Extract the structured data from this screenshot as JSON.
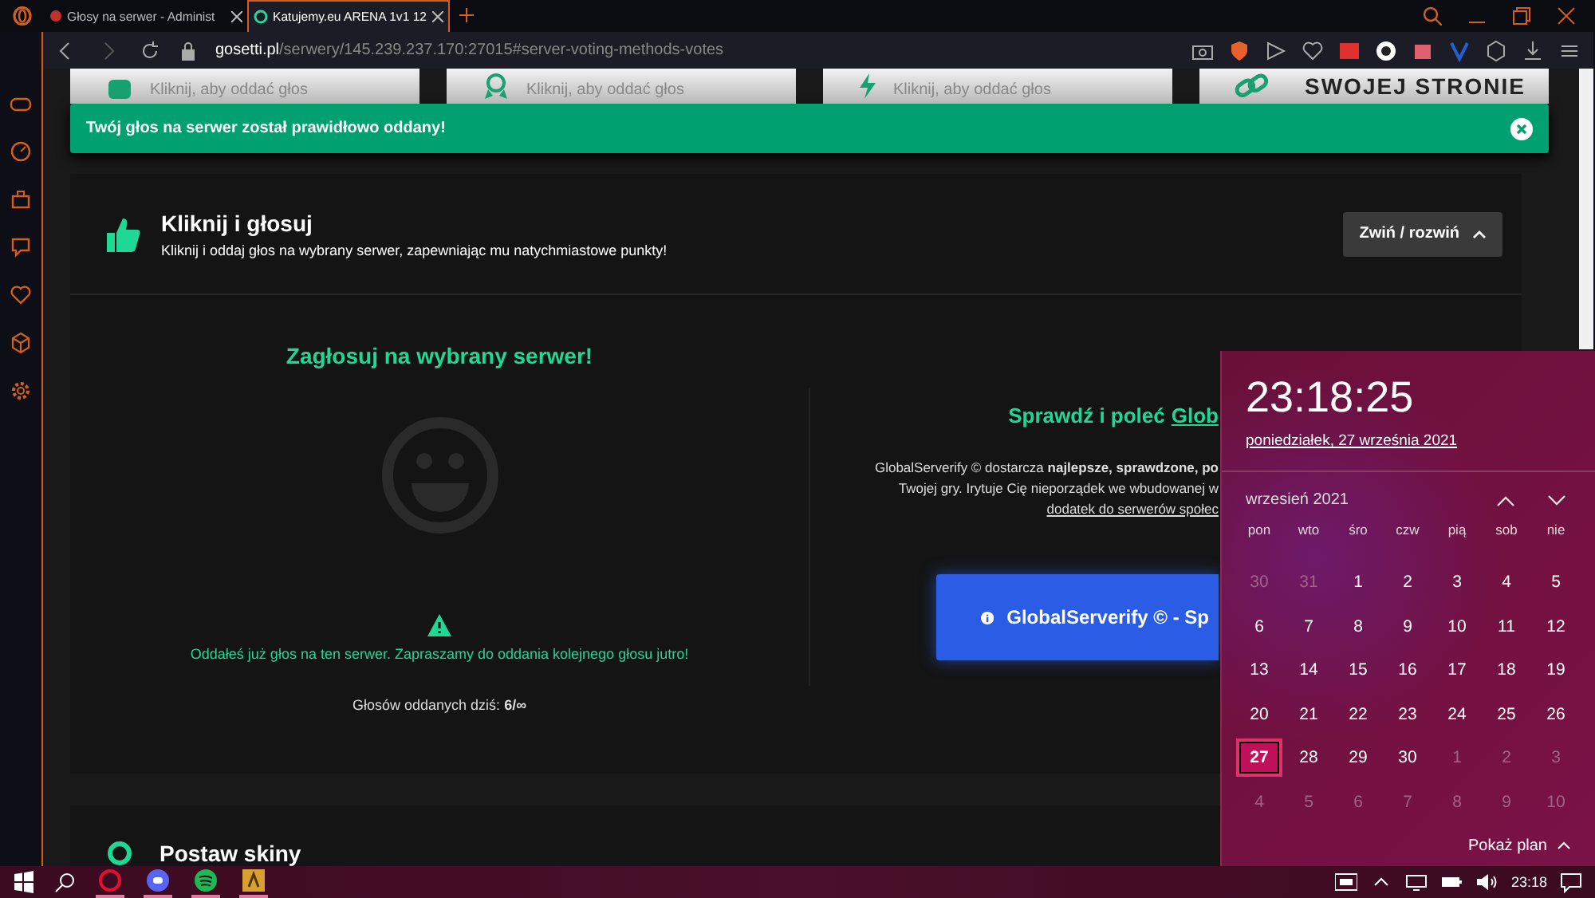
{
  "browser": {
    "tabs": [
      {
        "title": "Głosy na serwer - Administ",
        "selected": false
      },
      {
        "title": "Katujemy.eu ARENA 1v1 12",
        "selected": true
      }
    ],
    "url_host": "gosetti.pl",
    "url_path": "/serwery/145.239.237.170:27015#server-voting-methods-votes"
  },
  "vote_methods": [
    {
      "kind": "click",
      "subtitle": "Kliknij, aby oddać głos"
    },
    {
      "kind": "skins",
      "subtitle": "Kliknij, aby oddać głos"
    },
    {
      "kind": "sms",
      "subtitle": "Kliknij, aby oddać głos"
    },
    {
      "kind": "link",
      "title": "SWOJEJ STRONIE"
    }
  ],
  "alert": {
    "message": "Twój głos na serwer został prawidłowo oddany!"
  },
  "section": {
    "title": "Kliknij i głosuj",
    "description": "Kliknij i oddaj głos na wybrany serwer, zapewniając mu natychmiastowe punkty!",
    "toggle_button": "Zwiń / rozwiń"
  },
  "vote_panel": {
    "heading": "Zagłosuj na wybrany serwer!",
    "notice": "Oddałeś już głos na ten serwer. Zapraszamy do oddania kolejnego głosu jutro!",
    "votes_today": "Głosów oddanych dziś: **6/∞**"
  },
  "promo_panel": {
    "heading": "Sprawdź i poleć",
    "heading_link": "Glob",
    "lines": [
      "GlobalServerify © dostarcza **najlepsze, sprawdzone, po**",
      "Twojej gry. Irytuje Cię nieporządek we wbudowanej w"
    ],
    "link": "dodatek do serwerów społec",
    "button": "GlobalServerify © - Sp"
  },
  "next_section": {
    "title": "Postaw skiny"
  },
  "calendar": {
    "time": "23:18:25",
    "date": "poniedziałek, 27 września 2021",
    "month": "wrzesień 2021",
    "weekdays": [
      "pon",
      "wto",
      "śro",
      "czw",
      "pią",
      "sob",
      "nie"
    ],
    "days": [
      {
        "d": "30",
        "dim": true,
        "selected": false
      },
      {
        "d": "31",
        "dim": true,
        "selected": false
      },
      {
        "d": "1",
        "dim": false,
        "selected": false
      },
      {
        "d": "2",
        "dim": false,
        "selected": false
      },
      {
        "d": "3",
        "dim": false,
        "selected": false
      },
      {
        "d": "4",
        "dim": false,
        "selected": false
      },
      {
        "d": "5",
        "dim": false,
        "selected": false
      },
      {
        "d": "6",
        "dim": false,
        "selected": false
      },
      {
        "d": "7",
        "dim": false,
        "selected": false
      },
      {
        "d": "8",
        "dim": false,
        "selected": false
      },
      {
        "d": "9",
        "dim": false,
        "selected": false
      },
      {
        "d": "10",
        "dim": false,
        "selected": false
      },
      {
        "d": "11",
        "dim": false,
        "selected": false
      },
      {
        "d": "12",
        "dim": false,
        "selected": false
      },
      {
        "d": "13",
        "dim": false,
        "selected": false
      },
      {
        "d": "14",
        "dim": false,
        "selected": false
      },
      {
        "d": "15",
        "dim": false,
        "selected": false
      },
      {
        "d": "16",
        "dim": false,
        "selected": false
      },
      {
        "d": "17",
        "dim": false,
        "selected": false
      },
      {
        "d": "18",
        "dim": false,
        "selected": false
      },
      {
        "d": "19",
        "dim": false,
        "selected": false
      },
      {
        "d": "20",
        "dim": false,
        "selected": false
      },
      {
        "d": "21",
        "dim": false,
        "selected": false
      },
      {
        "d": "22",
        "dim": false,
        "selected": false
      },
      {
        "d": "23",
        "dim": false,
        "selected": false
      },
      {
        "d": "24",
        "dim": false,
        "selected": false
      },
      {
        "d": "25",
        "dim": false,
        "selected": false
      },
      {
        "d": "26",
        "dim": false,
        "selected": false
      },
      {
        "d": "27",
        "dim": false,
        "selected": true
      },
      {
        "d": "28",
        "dim": false,
        "selected": false
      },
      {
        "d": "29",
        "dim": false,
        "selected": false
      },
      {
        "d": "30",
        "dim": false,
        "selected": false
      },
      {
        "d": "1",
        "dim": true,
        "selected": false
      },
      {
        "d": "2",
        "dim": true,
        "selected": false
      },
      {
        "d": "3",
        "dim": true,
        "selected": false
      },
      {
        "d": "4",
        "dim": true,
        "selected": false
      },
      {
        "d": "5",
        "dim": true,
        "selected": false
      },
      {
        "d": "6",
        "dim": true,
        "selected": false
      },
      {
        "d": "7",
        "dim": true,
        "selected": false
      },
      {
        "d": "8",
        "dim": true,
        "selected": false
      },
      {
        "d": "9",
        "dim": true,
        "selected": false
      },
      {
        "d": "10",
        "dim": true,
        "selected": false
      }
    ],
    "footer": "Pokaż plan"
  },
  "taskbar": {
    "time": "23:18"
  }
}
